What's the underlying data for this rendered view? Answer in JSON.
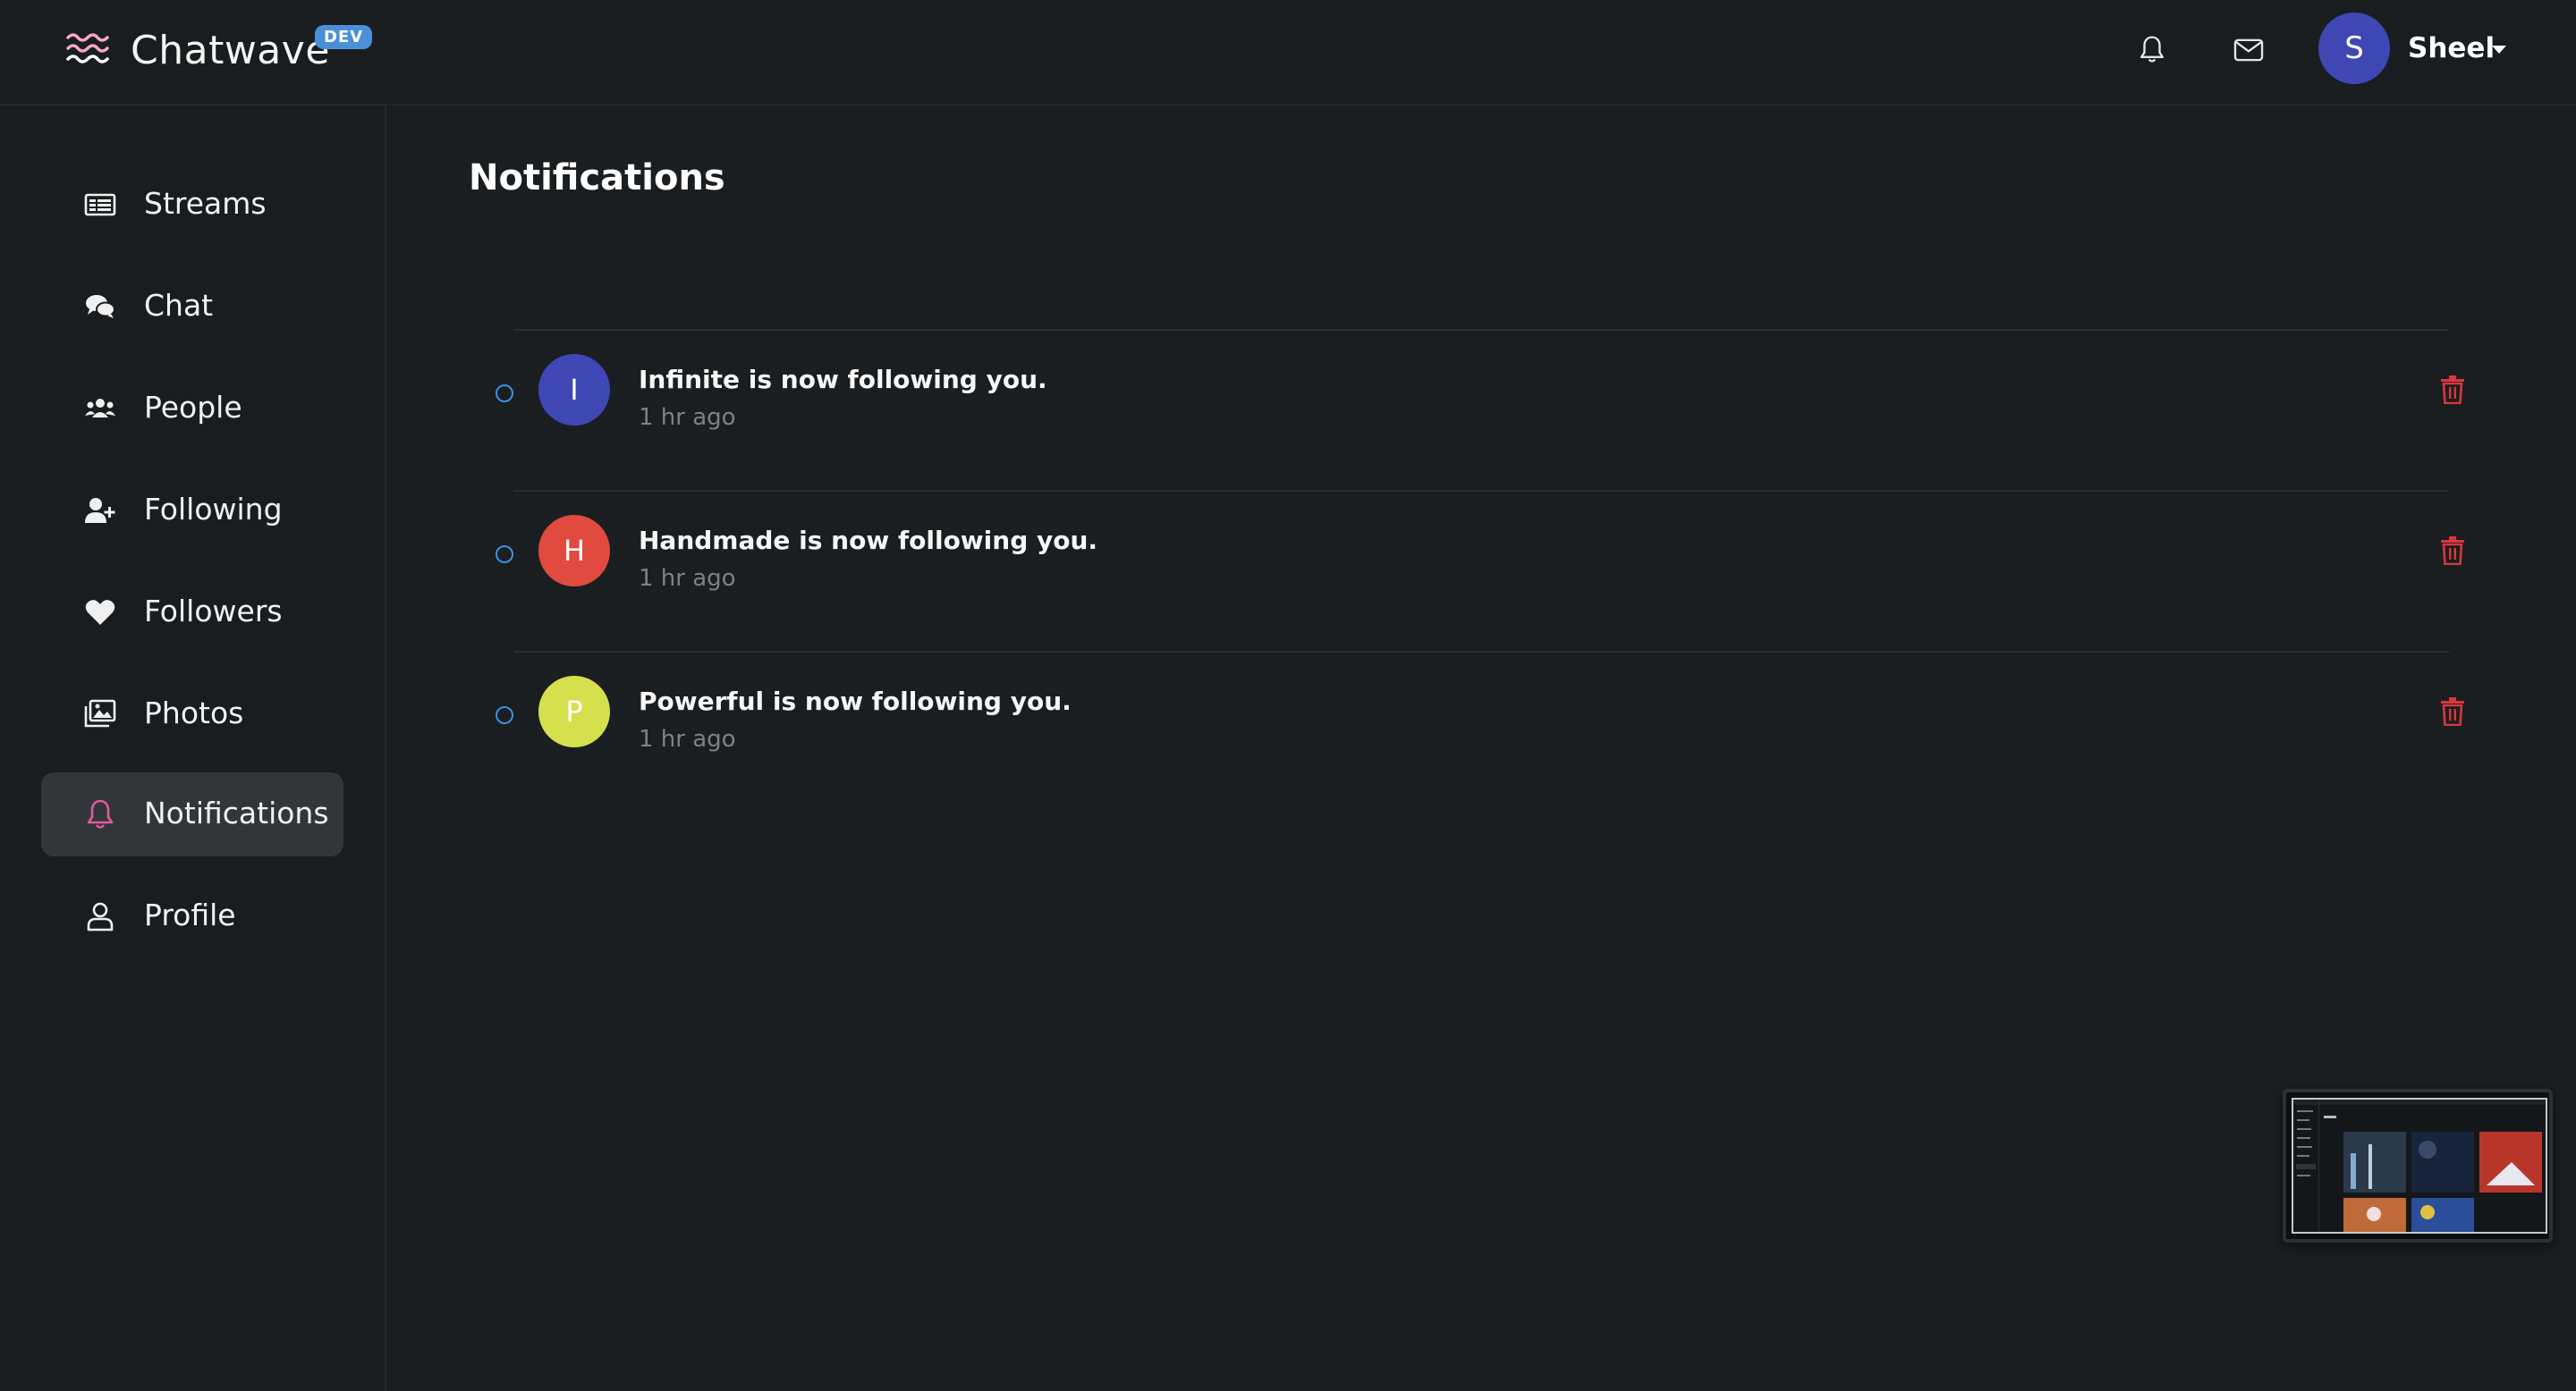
{
  "app": {
    "name": "Chatwave",
    "badge": "DEV"
  },
  "header": {
    "user_initial": "S",
    "user_name": "Sheel",
    "icons": [
      "bell-icon",
      "mail-icon",
      "caret-down-icon"
    ]
  },
  "sidebar": {
    "items": [
      {
        "label": "Streams",
        "icon": "streams-icon"
      },
      {
        "label": "Chat",
        "icon": "chat-icon"
      },
      {
        "label": "People",
        "icon": "people-icon"
      },
      {
        "label": "Following",
        "icon": "user-plus-icon"
      },
      {
        "label": "Followers",
        "icon": "heart-icon"
      },
      {
        "label": "Photos",
        "icon": "photos-icon"
      },
      {
        "label": "Notifications",
        "icon": "bell-icon",
        "active": true
      },
      {
        "label": "Profile",
        "icon": "user-icon"
      }
    ]
  },
  "main": {
    "title": "Notifications",
    "notifications": [
      {
        "initial": "I",
        "text": "Infinite is now following you.",
        "time": "1 hr ago",
        "color": "#3f47b5"
      },
      {
        "initial": "H",
        "text": "Handmade is now following you.",
        "time": "1 hr ago",
        "color": "#e04a3f"
      },
      {
        "initial": "P",
        "text": "Powerful is now following you.",
        "time": "1 hr ago",
        "color": "#d4e04c"
      }
    ]
  },
  "colors": {
    "background": "#1b1e20",
    "accent_blue": "#3d8fe6",
    "active_icon": "#e05aa0",
    "trash": "#d9363e"
  }
}
